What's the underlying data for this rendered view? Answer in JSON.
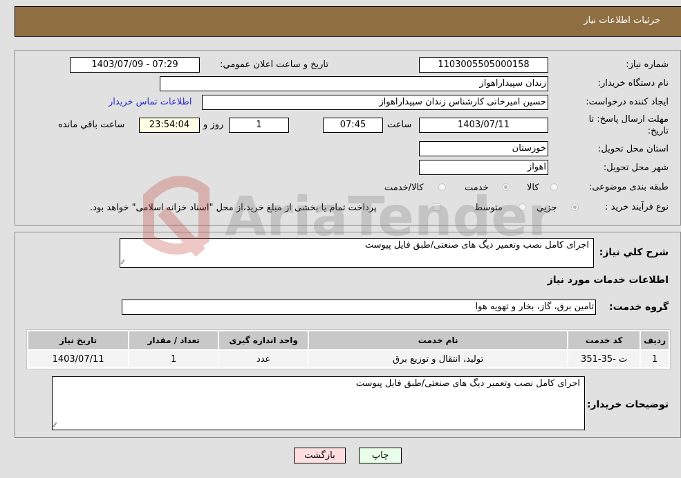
{
  "header": {
    "title": "جزئیات اطلاعات نیاز"
  },
  "form": {
    "need_number": {
      "label": "شماره نیاز:",
      "value": "1103005505000158"
    },
    "announce_datetime": {
      "label": "تاريخ و ساعت اعلان عمومي:",
      "value": "1403/07/09 - 07:29"
    },
    "buyer_org": {
      "label": "نام دستگاه خريدار:",
      "value": "زندان سپیداراهواز"
    },
    "requester": {
      "label": "ايجاد کننده درخواست:",
      "value": "حسین امیرخانی کارشناس زندان سپیداراهواز"
    },
    "buyer_contact_link": "اطلاعات تماس خريدار",
    "deadline": {
      "label_line1": "مهلت ارسال پاسخ: تا",
      "label_line2": "تاریخ:",
      "date": "1403/07/11",
      "time_label": "ساعت",
      "time": "07:45",
      "days": "1",
      "days_label": "روز و",
      "remaining": "23:54:04",
      "remaining_label": "ساعت باقي مانده"
    },
    "province": {
      "label": "استان محل تحويل:",
      "value": "خوزستان"
    },
    "city": {
      "label": "شهر محل تحويل:",
      "value": "اهواز"
    },
    "category": {
      "label": "طبقه بندی موضوعی:",
      "options": [
        "کالا",
        "خدمت",
        "کالا/خدمت"
      ],
      "selected": "خدمت"
    },
    "purchase_type": {
      "label": "نوع فرآيند خريد :",
      "options": [
        "جزيي",
        "متوسط"
      ],
      "selected": "جزيي",
      "treasury_note": "پرداخت تمام يا بخشی از مبلغ خريد،از محل \"اسناد خزانه اسلامی\" خواهد بود."
    }
  },
  "details": {
    "summary_label": "شرح كلي نياز:",
    "summary_value": "اجرای کامل نصب وتعمیر دیگ های صنعتی/طبق فایل پیوست",
    "services_heading": "اطلاعات خدمات مورد نياز",
    "service_group_label": "گروه خدمت:",
    "service_group_value": "تامین برق، گاز، بخار و تهویه هوا",
    "table": {
      "headers": [
        "رديف",
        "کد خدمت",
        "نام خدمت",
        "واحد اندازه گيری",
        "تعداد / مقدار",
        "تاريخ نياز"
      ],
      "rows": [
        [
          "1",
          "ت -35-351",
          "تولید، انتقال و توزیع برق",
          "عدد",
          "1",
          "1403/07/11"
        ]
      ]
    },
    "buyer_notes_label": "توضيحات خريدار:",
    "buyer_notes_value": "اجرای کامل نصب وتعمیر دیگ های صنعتی/طبق فایل پیوست"
  },
  "buttons": {
    "print": "چاپ",
    "back": "بازگشت"
  },
  "watermark": "AriaTender.neT",
  "colors": {
    "header_bg": "#8f6e42",
    "print_bg": "#eaffea",
    "back_bg": "#ffdede",
    "remaining_bg": "#ffffe6",
    "link": "#2a2ad4"
  }
}
